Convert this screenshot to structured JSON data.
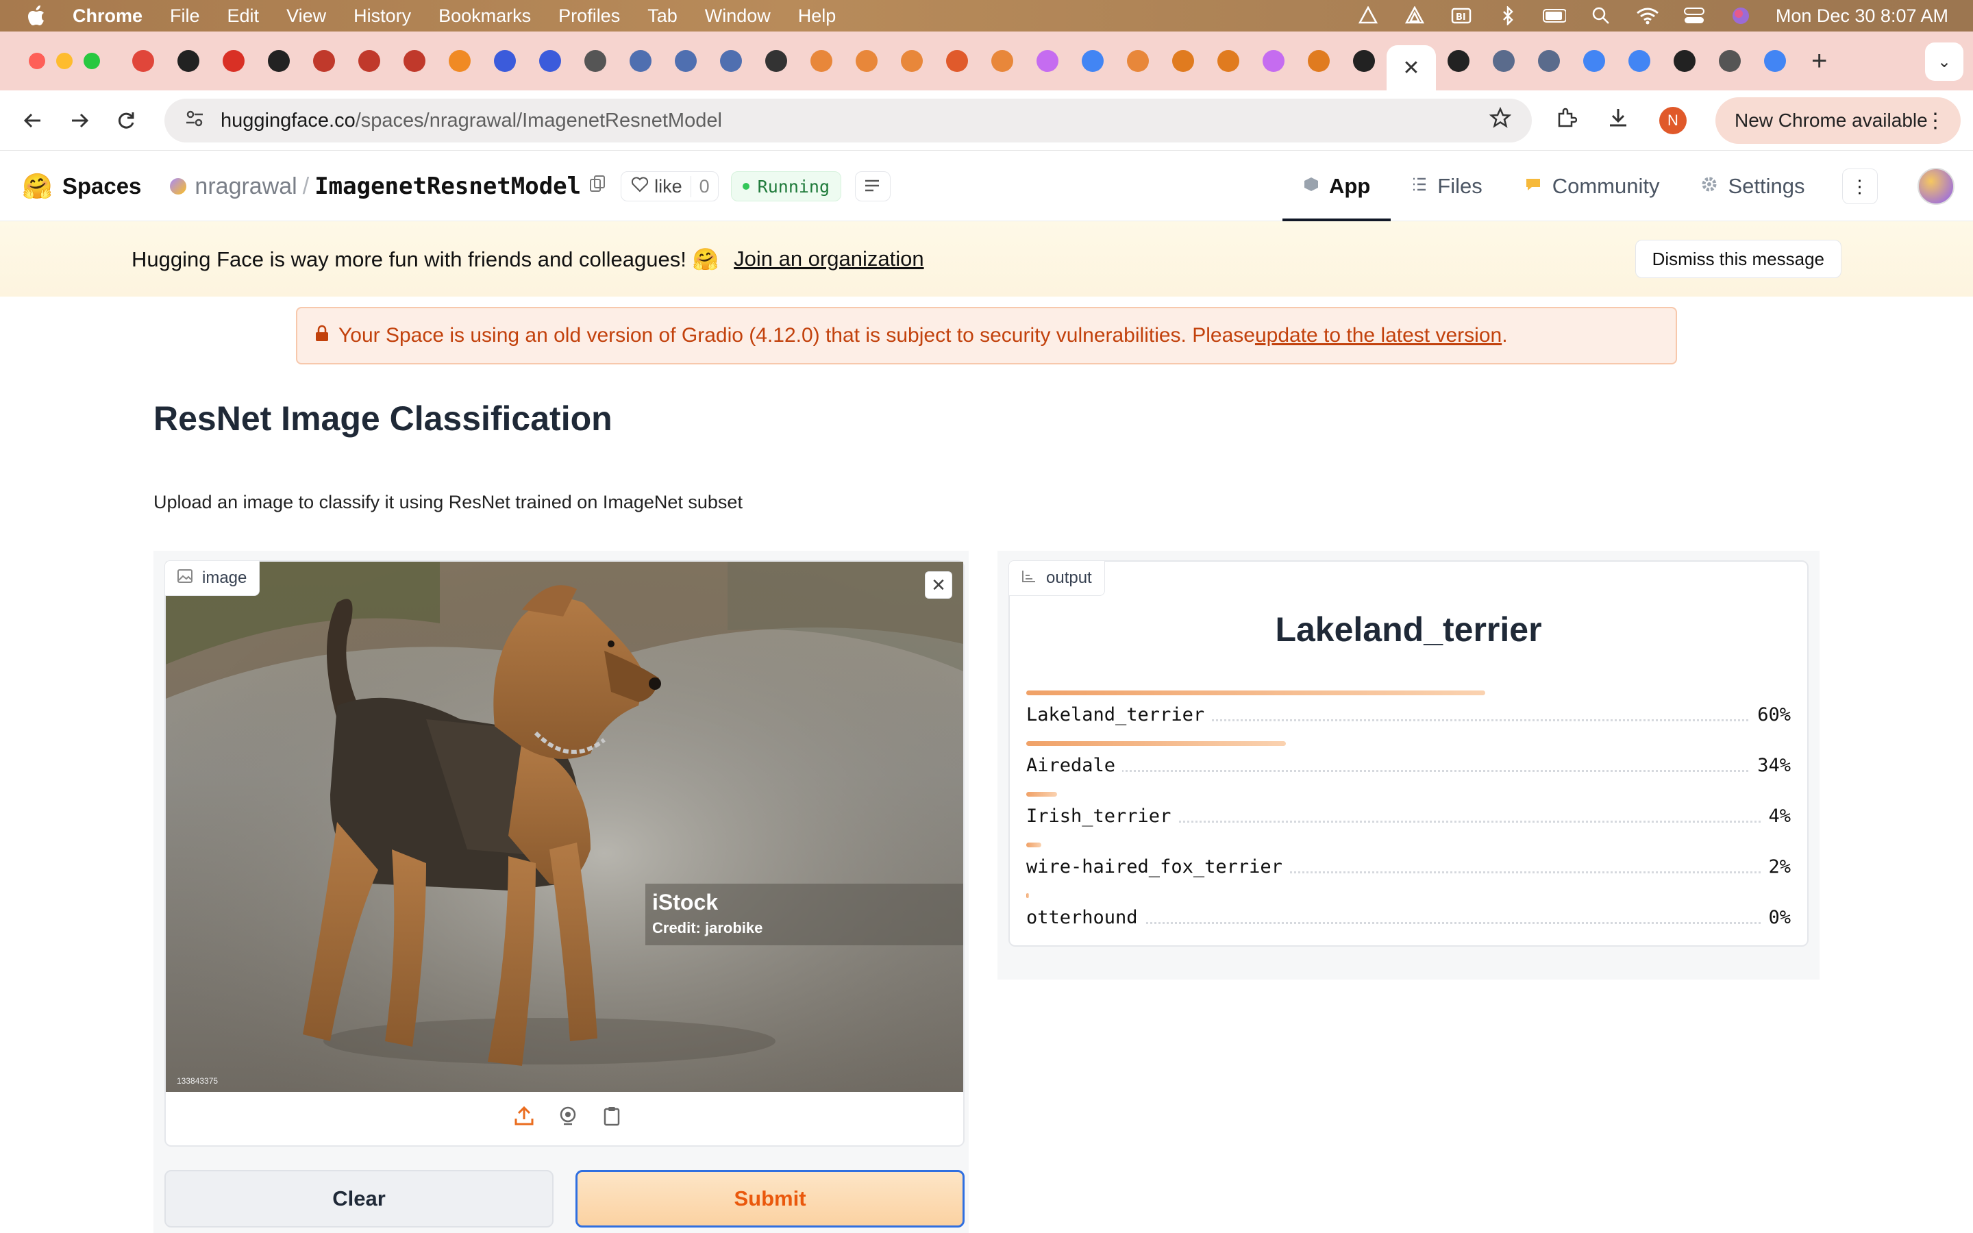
{
  "menubar": {
    "app_name": "Chrome",
    "items": [
      "File",
      "Edit",
      "View",
      "History",
      "Bookmarks",
      "Profiles",
      "Tab",
      "Window",
      "Help"
    ],
    "clock": "Mon Dec 30  8:07 AM"
  },
  "tabs": {
    "favicon_colors": [
      "#e0463a",
      "#222222",
      "#d93025",
      "#222222",
      "#c0392b",
      "#c0392b",
      "#c0392b",
      "#f08a24",
      "#3b5bdb",
      "#3b5bdb",
      "#555555",
      "#4f6fb0",
      "#4f6fb0",
      "#4f6fb0",
      "#333333",
      "#e8873a",
      "#e8873a",
      "#e8873a",
      "#e05a2b",
      "#e8873a",
      "#c56cf0",
      "#4285f4",
      "#e8873a",
      "#e07b1f",
      "#e07b1f",
      "#c56cf0",
      "#e07b1f",
      "#222222"
    ],
    "active_close_glyph": "✕",
    "after_active_colors": [
      "#222222",
      "#5a6b8c",
      "#5a6b8c",
      "#4285f4",
      "#4285f4",
      "#222222",
      "#555555",
      "#4285f4"
    ],
    "new_tab_glyph": "+",
    "menu_glyph": "⌄"
  },
  "toolbar": {
    "url_host": "huggingface.co",
    "url_path": "/spaces/nragrawal/ImagenetResnetModel",
    "profile_initial": "N",
    "new_chrome_label": "New Chrome available"
  },
  "hf_header": {
    "spaces_label": "Spaces",
    "owner": "nragrawal",
    "repo": "ImagenetResnetModel",
    "like_label": "like",
    "like_count": "0",
    "status": "Running",
    "nav": [
      {
        "label": "App",
        "icon": "cube-icon"
      },
      {
        "label": "Files",
        "icon": "files-icon"
      },
      {
        "label": "Community",
        "icon": "community-icon"
      },
      {
        "label": "Settings",
        "icon": "gear-icon"
      }
    ]
  },
  "banner": {
    "message": "Hugging Face is way more fun with friends and colleagues! 🤗",
    "link": "Join an organization",
    "dismiss": "Dismiss this message"
  },
  "warning": {
    "text": "Your Space is using an old version of Gradio (4.12.0) that is subject to security vulnerabilities. Please ",
    "link": "update to the latest version",
    "suffix": "."
  },
  "app": {
    "title": "ResNet Image Classification",
    "description": "Upload an image to classify it using ResNet trained on ImageNet subset",
    "image_label": "image",
    "watermark_brand": "iStock",
    "watermark_credit": "Credit: jarobike",
    "watermark_id": "133843375",
    "output_label": "output",
    "top_prediction": "Lakeland_terrier",
    "predictions": [
      {
        "label": "Lakeland_terrier",
        "pct": "60%",
        "value": 0.6
      },
      {
        "label": "Airedale",
        "pct": "34%",
        "value": 0.34
      },
      {
        "label": "Irish_terrier",
        "pct": "4%",
        "value": 0.04
      },
      {
        "label": "wire-haired_fox_terrier",
        "pct": "2%",
        "value": 0.02
      },
      {
        "label": "otterhound",
        "pct": "0%",
        "value": 0.004
      }
    ],
    "clear_button": "Clear",
    "submit_button": "Submit"
  }
}
